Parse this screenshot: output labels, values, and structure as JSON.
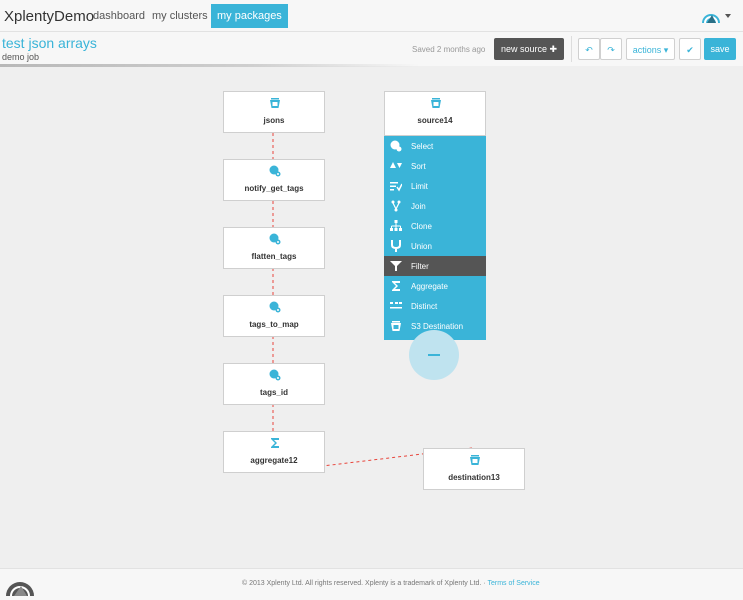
{
  "app": {
    "brand": "XplentyDemo"
  },
  "nav": {
    "dashboard": "dashboard",
    "clusters": "my clusters",
    "packages": "my packages"
  },
  "job": {
    "title": "test json arrays",
    "subtitle": "demo job",
    "saved": "Saved 2 months ago"
  },
  "toolbar": {
    "new_source": "new source ✚",
    "undo": "↶",
    "redo": "↷",
    "actions": "actions ▾",
    "check": "✔",
    "save": "save"
  },
  "nodes": {
    "jsons": "jsons",
    "notify": "notify_get_tags",
    "flatten": "flatten_tags",
    "tomap": "tags_to_map",
    "tagsid": "tags_id",
    "aggregate": "aggregate12",
    "source": "source14",
    "destination": "destination13"
  },
  "menu": {
    "select": "Select",
    "sort": "Sort",
    "limit": "Limit",
    "join": "Join",
    "clone": "Clone",
    "union": "Union",
    "filter": "Filter",
    "aggregate": "Aggregate",
    "distinct": "Distinct",
    "s3dest": "S3 Destination"
  },
  "footer": {
    "copyright": "© 2013 Xplenty Ltd. All rights reserved. Xplenty is a trademark of Xplenty Ltd. ·",
    "terms": "Terms of Service"
  },
  "colors": {
    "accent": "#3ab4d8",
    "dark": "#555555",
    "link": "#e8453c"
  },
  "icons": {
    "component": "bucket-icon",
    "transform": "gear-cog-icon",
    "sum": "sigma-icon"
  }
}
